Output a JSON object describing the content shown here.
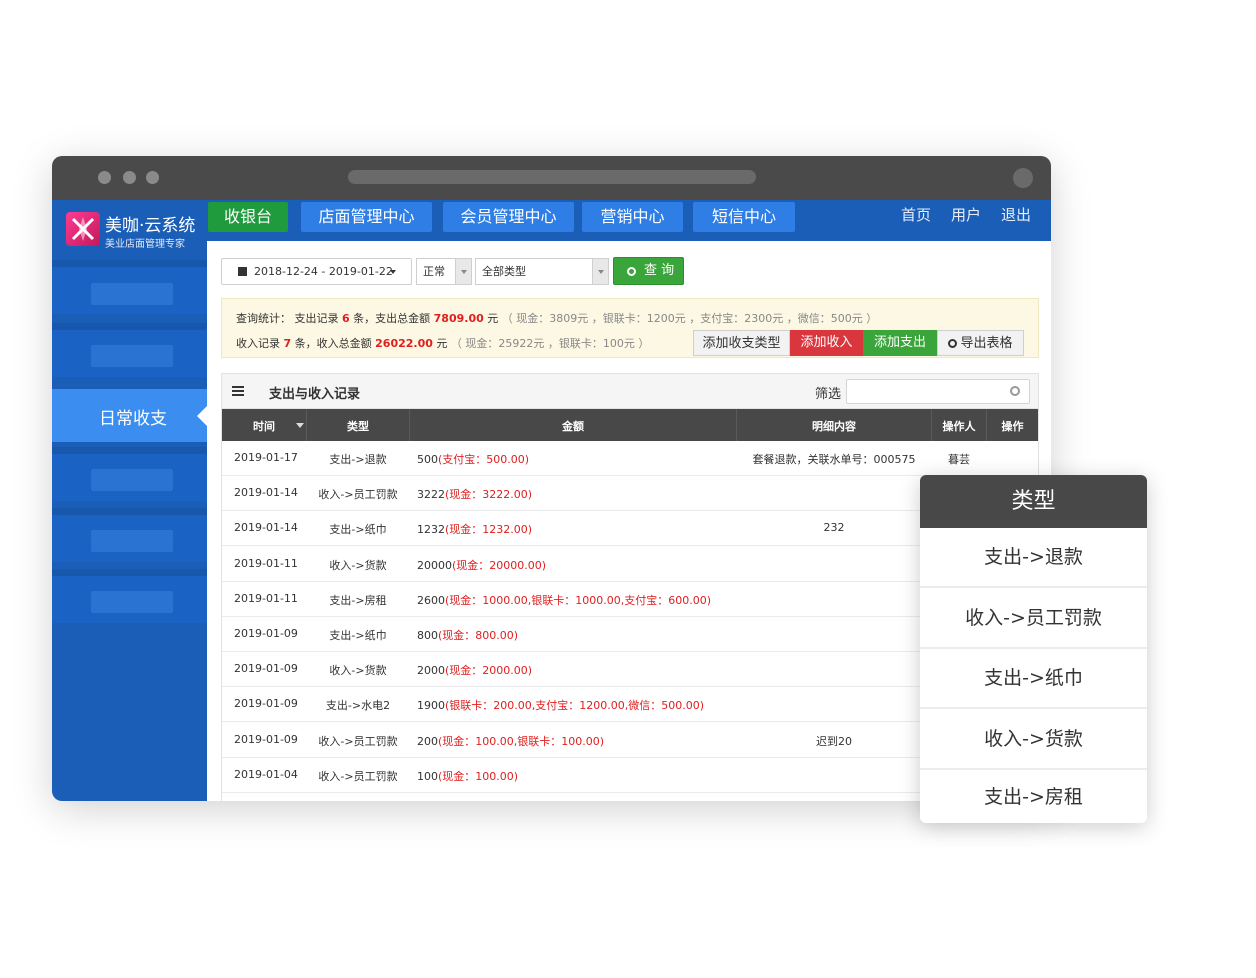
{
  "brand": {
    "name": "美咖·云系统",
    "subtitle": "美业店面管理专家"
  },
  "sidebar": {
    "active_item": "日常收支"
  },
  "topnav": {
    "tabs": [
      {
        "label": "收银台",
        "color": "#1f9a3c"
      },
      {
        "label": "店面管理中心",
        "color": "#2e7ee6"
      },
      {
        "label": "会员管理中心",
        "color": "#2e7ee6"
      },
      {
        "label": "营销中心",
        "color": "#2e7ee6"
      },
      {
        "label": "短信中心",
        "color": "#2e7ee6"
      }
    ],
    "links": [
      "首页",
      "用户",
      "退出"
    ]
  },
  "filters": {
    "date_range": "2018-12-24 - 2019-01-22",
    "status": "正常",
    "type": "全部类型",
    "query_button": "查 询"
  },
  "stats": {
    "label": "查询统计：",
    "expense": {
      "prefix": "支出记录",
      "count": "6",
      "mid": "条，支出总金额",
      "total": "7809.00",
      "unit": "元",
      "detail": "（ 现金：3809元 ，银联卡：1200元 ，支付宝：2300元 ，微信：500元 ）"
    },
    "income": {
      "prefix": "收入记录",
      "count": "7",
      "mid": "条，收入总金额",
      "total": "26022.00",
      "unit": "元",
      "detail": "（ 现金：25922元 ，银联卡：100元 ）"
    }
  },
  "actions": [
    {
      "label": "添加收支类型",
      "color": "#f2f2f2"
    },
    {
      "label": "添加收入",
      "color": "#d9363e"
    },
    {
      "label": "添加支出",
      "color": "#3aa53a"
    },
    {
      "label": "导出表格",
      "color": "#f2f2f2"
    }
  ],
  "table": {
    "title": "支出与收入记录",
    "filter_label": "筛选",
    "columns": [
      "时间",
      "类型",
      "金额",
      "明细内容",
      "操作人",
      "操作"
    ],
    "rows": [
      {
        "date": "2019-01-17",
        "type": "支出->退款",
        "amount": "500",
        "amount_detail": "(支付宝：500.00)",
        "detail": "套餐退款，关联水单号：000575",
        "operator": "暮芸"
      },
      {
        "date": "2019-01-14",
        "type": "收入->员工罚款",
        "amount": "3222",
        "amount_detail": "(现金：3222.00)",
        "detail": "",
        "operator": ""
      },
      {
        "date": "2019-01-14",
        "type": "支出->纸巾",
        "amount": "1232",
        "amount_detail": "(现金：1232.00)",
        "detail": "232",
        "operator": ""
      },
      {
        "date": "2019-01-11",
        "type": "收入->货款",
        "amount": "20000",
        "amount_detail": "(现金：20000.00)",
        "detail": "",
        "operator": ""
      },
      {
        "date": "2019-01-11",
        "type": "支出->房租",
        "amount": "2600",
        "amount_detail": "(现金：1000.00,银联卡：1000.00,支付宝：600.00)",
        "detail": "",
        "operator": ""
      },
      {
        "date": "2019-01-09",
        "type": "支出->纸巾",
        "amount": "800",
        "amount_detail": "(现金：800.00)",
        "detail": "",
        "operator": ""
      },
      {
        "date": "2019-01-09",
        "type": "收入->货款",
        "amount": "2000",
        "amount_detail": "(现金：2000.00)",
        "detail": "",
        "operator": ""
      },
      {
        "date": "2019-01-09",
        "type": "支出->水电2",
        "amount": "1900",
        "amount_detail": "(银联卡：200.00,支付宝：1200.00,微信：500.00)",
        "detail": "",
        "operator": ""
      },
      {
        "date": "2019-01-09",
        "type": "收入->员工罚款",
        "amount": "200",
        "amount_detail": "(现金：100.00,银联卡：100.00)",
        "detail": "迟到20",
        "operator": ""
      },
      {
        "date": "2019-01-04",
        "type": "收入->员工罚款",
        "amount": "100",
        "amount_detail": "(现金：100.00)",
        "detail": "",
        "operator": ""
      }
    ]
  },
  "popup": {
    "title": "类型",
    "items": [
      "支出->退款",
      "收入->员工罚款",
      "支出->纸巾",
      "收入->货款",
      "支出->房租"
    ]
  }
}
